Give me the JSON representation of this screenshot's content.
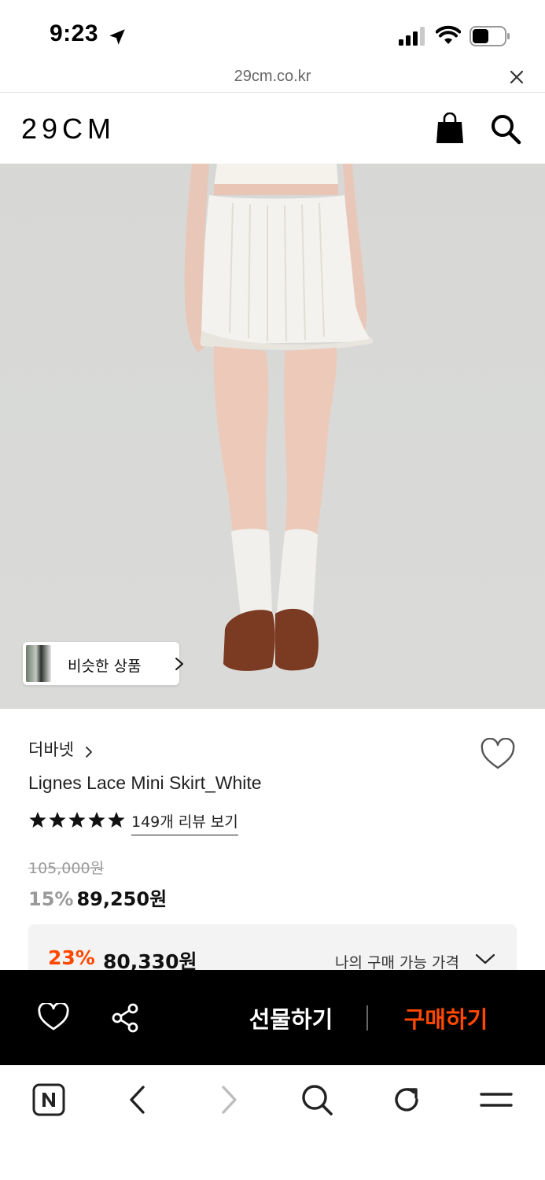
{
  "status_bar": {
    "time": "9:23"
  },
  "url_bar": {
    "domain": "29cm.co.kr"
  },
  "header": {
    "logo": "29CM"
  },
  "product": {
    "similar_button_label": "비슷한 상품",
    "brand": "더바넷",
    "name": "Lignes Lace Mini Skirt_White",
    "rating_stars": 5,
    "review_link": "149개 리뷰 보기",
    "original_price": "105,000원",
    "discount_rate": "15%",
    "sale_price": "89,250원"
  },
  "my_price": {
    "rate": "23%",
    "price": "80,330원",
    "label": "나의 구매 가능 가격"
  },
  "purchase_bar": {
    "gift_label": "선물하기",
    "buy_label": "구매하기"
  },
  "colors": {
    "accent": "#ff4800",
    "bar_bg": "#000000",
    "muted": "#9a9a9a",
    "box_bg": "#f3f3f4"
  }
}
